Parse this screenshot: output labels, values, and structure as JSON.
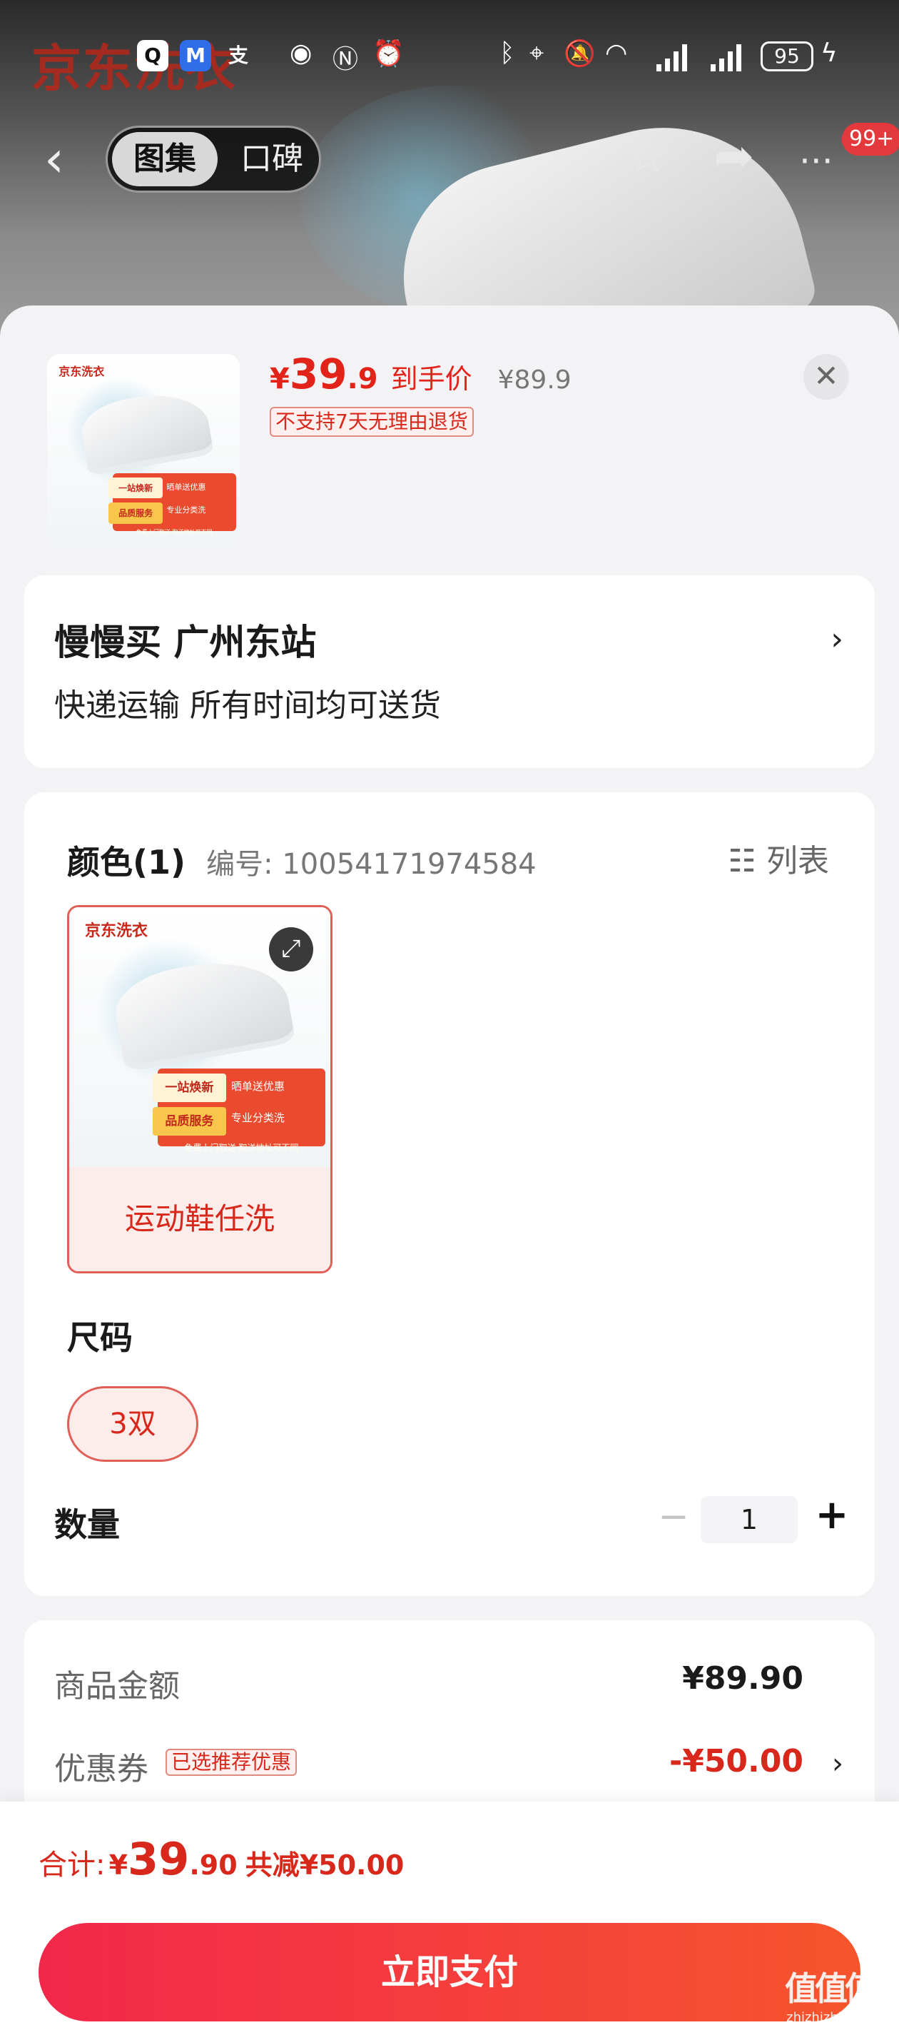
{
  "status_bar": {
    "apps": [
      "Q",
      "M",
      "支"
    ],
    "battery": "95"
  },
  "header": {
    "background_brand": "京东洗衣",
    "tabs": [
      "图集",
      "口碑"
    ],
    "message_badge": "99+",
    "icons": [
      "back-icon",
      "star-icon",
      "share-icon",
      "more-icon"
    ]
  },
  "product": {
    "price_currency": "¥",
    "price_integer": "39",
    "price_decimal": ".9",
    "price_label": "到手价",
    "original_price": "¥89.9",
    "return_policy": "不支持7天无理由退货",
    "image_brand": "京东洗衣",
    "image_tags": [
      "一站焕新",
      "品质服务",
      "晒单送优惠",
      "专业分类洗",
      "免费上门取送 取送地址可不同"
    ]
  },
  "address": {
    "title": "慢慢买  广州东站",
    "delivery": "快递运输 所有时间均可送货"
  },
  "spec": {
    "color_title": "颜色(1)",
    "sku_number": "编号: 10054171974584",
    "list_toggle": "列表",
    "option_label": "运动鞋任洗",
    "size_title": "尺码",
    "size_option": "3双",
    "quantity_title": "数量",
    "quantity": "1"
  },
  "summary": {
    "goods_label": "商品金额",
    "goods_value": "¥89.90",
    "coupon_label": "优惠券",
    "coupon_tag": "已选推荐优惠",
    "coupon_value": "-¥50.00"
  },
  "footer": {
    "total_label": "合计:",
    "total_currency": "¥",
    "total_integer": "39",
    "total_decimal": ".90",
    "total_saving": "共减¥50.00",
    "pay_button": "立即支付"
  },
  "watermark": {
    "text": "值值值",
    "url": "zhizhizhi.com"
  },
  "colors": {
    "accent": "#e2231a",
    "pay_gradient_start": "#f2284b",
    "pay_gradient_end": "#f6552c"
  }
}
